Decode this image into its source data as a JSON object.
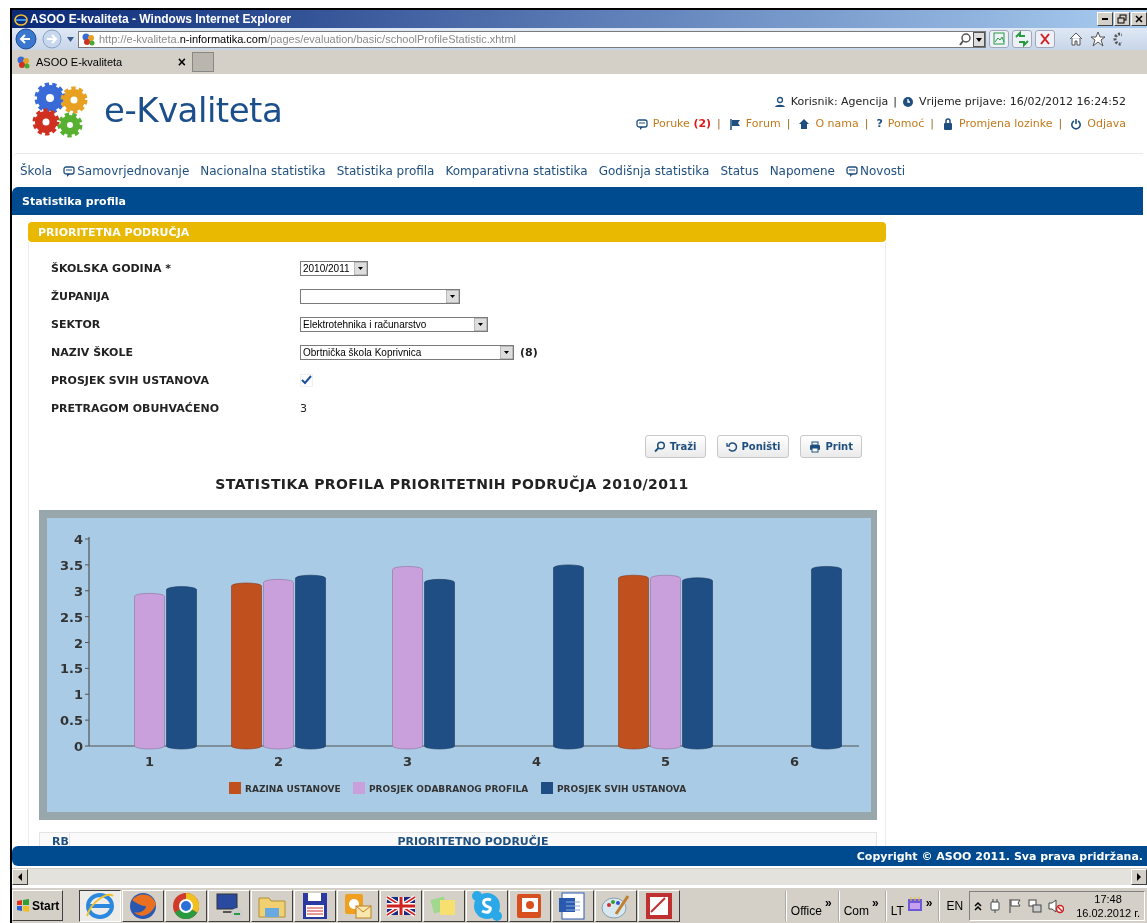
{
  "browser": {
    "title": "ASOO E-kvaliteta - Windows Internet Explorer",
    "url": "http://e-kvaliteta.**n-informatika.com**/pages/evaluation/basic/schoolProfileStatistic.xhtml",
    "tab": {
      "label": "ASOO E-kvaliteta",
      "close": "×"
    }
  },
  "header": {
    "logo_text": "e-Kvaliteta",
    "user": "Korisnik: Agencija",
    "user_separator": "|",
    "login_time": "Vrijeme prijave: 16/02/2012 16:24:52",
    "links": [
      {
        "label": "Poruke",
        "badge": "(2)",
        "separator": "|"
      },
      {
        "label": "Forum",
        "separator": "|"
      },
      {
        "label": "O nama",
        "separator": "|"
      },
      {
        "label": "Pomoć",
        "icon_char": "?",
        "separator": "|"
      },
      {
        "label": "Promjena lozinke",
        "separator": "|"
      },
      {
        "label": "Odjava"
      }
    ]
  },
  "nav": [
    {
      "label": "Škola",
      "icon": false
    },
    {
      "label": "Samovrjednovanje",
      "icon": true
    },
    {
      "label": "Nacionalna statistika",
      "icon": false
    },
    {
      "label": "Statistika profila",
      "icon": false
    },
    {
      "label": "Komparativna statistika",
      "icon": false
    },
    {
      "label": "Godišnja statistika",
      "icon": false
    },
    {
      "label": "Status",
      "icon": false
    },
    {
      "label": "Napomene",
      "icon": false
    },
    {
      "label": "Novosti",
      "icon": true
    }
  ],
  "breadcrumb": "Statistika profila",
  "panel": {
    "title": "PRIORITETNA PODRUČJA",
    "fields": [
      {
        "label": "ŠKOLSKA GODINA *",
        "kind": "select",
        "value": "2010/2011"
      },
      {
        "label": "ŽUPANIJA",
        "kind": "select"
      },
      {
        "label": "SEKTOR",
        "kind": "select",
        "value": "Elektrotehnika i računarstvo"
      },
      {
        "label": "NAZIV ŠKOLE",
        "kind": "select",
        "value": "Obrtnička škola Koprivnica",
        "suffix": "(8)"
      },
      {
        "label": "PROSJEK SVIH USTANOVA",
        "kind": "checkbox",
        "checked": true
      },
      {
        "label": "PRETRAGOM OBUHVAĆENO",
        "kind": "text",
        "value": "3"
      }
    ],
    "buttons": [
      "Traži",
      "Poništi",
      "Print"
    ],
    "chart": {
      "title": "STATISTIKA PROFILA PRIORITETNIH PODRUČJA 2010/2011",
      "chart_data": {
        "type": "bar",
        "categories": [
          "1",
          "2",
          "3",
          "4",
          "5",
          "6"
        ],
        "series": [
          {
            "name": "RAZINA USTANOVE",
            "color": "#c1501f",
            "values": [
              null,
              3.15,
              null,
              null,
              3.3,
              null
            ]
          },
          {
            "name": "PROSJEK ODABRANOG PROFILA",
            "color": "#c9a0dc",
            "values": [
              2.95,
              3.22,
              3.47,
              null,
              3.3,
              null
            ]
          },
          {
            "name": "PROSJEK SVIH USTANOVA",
            "color": "#1f4e85",
            "values": [
              3.08,
              3.3,
              3.22,
              3.5,
              3.25,
              3.47
            ]
          }
        ],
        "legend": "bottom",
        "ylim": [
          0,
          4
        ],
        "yticks": [
          0,
          {
            "value": 0.5,
            "label": "0.5"
          },
          1,
          {
            "value": 1.5,
            "label": "1.5"
          },
          2,
          {
            "value": 2.5,
            "label": "2.5"
          },
          3,
          {
            "value": 3.5,
            "label": "3.5"
          },
          4
        ]
      }
    },
    "table": {
      "columns": [
        "RB",
        "PRIORITETNO PODRUČJE"
      ]
    }
  },
  "footer": {
    "copyright": "Copyright © ASOO 2011. Sva prava pridržana."
  },
  "taskbar": {
    "start": "Start",
    "apps": [
      {
        "selected": true
      },
      {
        "selected": false
      },
      {
        "selected": false
      },
      {
        "selected": false
      },
      {
        "selected": false
      },
      {
        "selected": false
      },
      {
        "selected": false
      },
      {
        "selected": false
      },
      {
        "selected": false
      },
      {
        "selected": false
      },
      {
        "selected": false
      },
      {
        "selected": false
      },
      {
        "selected": false
      },
      {
        "selected": false
      }
    ],
    "toolbars": [
      {
        "label": "Office",
        "chevron": "»"
      },
      {
        "label": "Com",
        "chevron": "»"
      },
      {
        "label": "LT",
        "chevron": "»"
      }
    ],
    "language": "EN",
    "time": "17:48",
    "date": "16.02.2012 г."
  }
}
